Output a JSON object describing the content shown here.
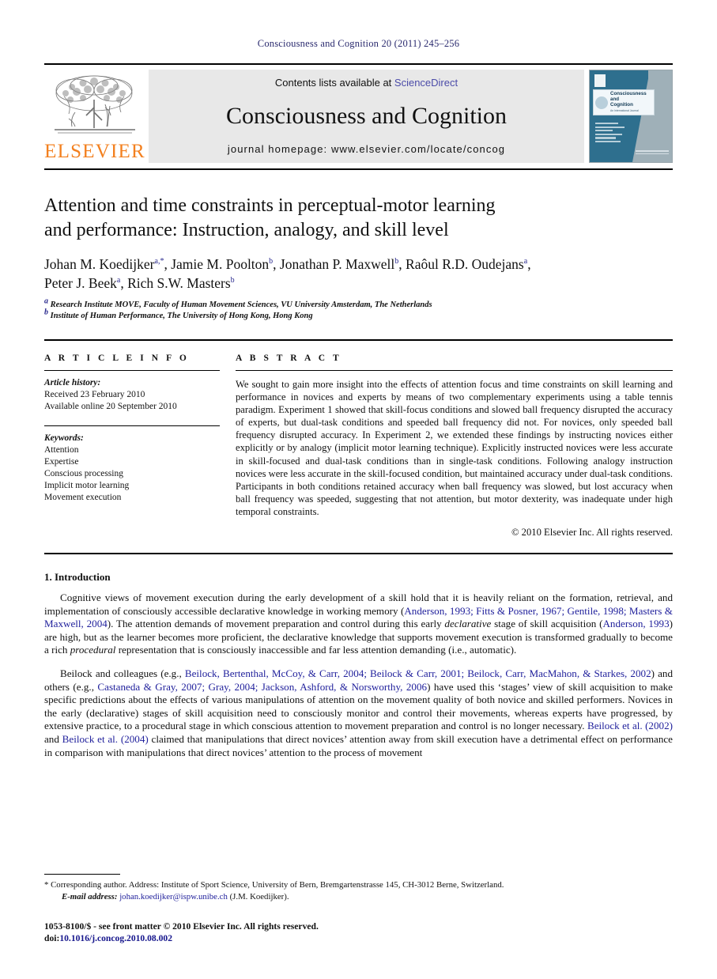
{
  "running_head": "Consciousness and Cognition 20 (2011) 245–256",
  "journal_header": {
    "publisher_logo_text": "ELSEVIER",
    "contents_prefix": "Contents lists available at ",
    "contents_link": "ScienceDirect",
    "journal_title": "Consciousness and Cognition",
    "homepage": "journal homepage: www.elsevier.com/locate/concog",
    "cover": {
      "title_line1": "Consciousness",
      "title_line2": "and",
      "title_line3": "Cognition",
      "subtitle": "An International Journal"
    }
  },
  "article": {
    "title_line1": "Attention and time constraints in perceptual-motor learning",
    "title_line2": "and performance: Instruction, analogy, and skill level",
    "authors_line1": "Johan M. Koedijker a,*, Jamie M. Poolton b, Jonathan P. Maxwell b, Raôul R.D. Oudejans a,",
    "authors_line2": "Peter J. Beek a, Rich S.W. Masters b",
    "affiliations": [
      "a Research Institute MOVE, Faculty of Human Movement Sciences, VU University Amsterdam, The Netherlands",
      "b Institute of Human Performance, The University of Hong Kong, Hong Kong"
    ]
  },
  "article_info": {
    "heading": "A R T I C L E   I N F O",
    "history_label": "Article history:",
    "history": [
      "Received 23 February 2010",
      "Available online 20 September 2010"
    ],
    "keywords_label": "Keywords:",
    "keywords": [
      "Attention",
      "Expertise",
      "Conscious processing",
      "Implicit motor learning",
      "Movement execution"
    ]
  },
  "abstract": {
    "heading": "A B S T R A C T",
    "text": "We sought to gain more insight into the effects of attention focus and time constraints on skill learning and performance in novices and experts by means of two complementary experiments using a table tennis paradigm. Experiment 1 showed that skill-focus conditions and slowed ball frequency disrupted the accuracy of experts, but dual-task conditions and speeded ball frequency did not. For novices, only speeded ball frequency disrupted accuracy. In Experiment 2, we extended these findings by instructing novices either explicitly or by analogy (implicit motor learning technique). Explicitly instructed novices were less accurate in skill-focused and dual-task conditions than in single-task conditions. Following analogy instruction novices were less accurate in the skill-focused condition, but maintained accuracy under dual-task conditions. Participants in both conditions retained accuracy when ball frequency was slowed, but lost accuracy when ball frequency was speeded, suggesting that not attention, but motor dexterity, was inadequate under high temporal constraints.",
    "copyright": "© 2010 Elsevier Inc. All rights reserved."
  },
  "body": {
    "section_heading": "1. Introduction",
    "paragraph1_part1": "Cognitive views of movement execution during the early development of a skill hold that it is heavily reliant on the formation, retrieval, and implementation of consciously accessible declarative knowledge in working memory (",
    "paragraph1_ref1": "Anderson, 1993; Fitts & Posner, 1967; Gentile, 1998; Masters & Maxwell, 2004",
    "paragraph1_part2": "). The attention demands of movement preparation and control during this early ",
    "paragraph1_ital1": "declarative",
    "paragraph1_part3": " stage of skill acquisition (",
    "paragraph1_ref2": "Anderson, 1993",
    "paragraph1_part4": ") are high, but as the learner becomes more proficient, the declarative knowledge that supports movement execution is transformed gradually to become a rich ",
    "paragraph1_ital2": "procedural",
    "paragraph1_part5": " representation that is consciously inaccessible and far less attention demanding (i.e., automatic).",
    "paragraph2_part1": "Beilock and colleagues (e.g., ",
    "paragraph2_ref1": "Beilock, Bertenthal, McCoy, & Carr, 2004; Beilock & Carr, 2001; Beilock, Carr, MacMahon, & Starkes, 2002",
    "paragraph2_part2": ") and others (e.g., ",
    "paragraph2_ref2": "Castaneda & Gray, 2007; Gray, 2004; Jackson, Ashford, & Norsworthy, 2006",
    "paragraph2_part3": ") have used this ‘stages’ view of skill acquisition to make specific predictions about the effects of various manipulations of attention on the movement quality of both novice and skilled performers. Novices in the early (declarative) stages of skill acquisition need to consciously monitor and control their movements, whereas experts have progressed, by extensive practice, to a procedural stage in which conscious attention to movement preparation and control is no longer necessary. ",
    "paragraph2_ref3": "Beilock et al. (2002)",
    "paragraph2_part4": " and ",
    "paragraph2_ref4": "Beilock et al. (2004)",
    "paragraph2_part5": " claimed that manipulations that direct novices’ attention away from skill execution have a detrimental effect on performance in comparison with manipulations that direct novices’ attention to the process of movement"
  },
  "footnote": {
    "marker": "*",
    "corresponding_text": "Corresponding author. Address: Institute of Sport Science, University of Bern, Bremgartenstrasse 145, CH-3012 Berne, Switzerland.",
    "email_label": "E-mail address:",
    "email": "johan.koedijker@ispw.unibe.ch",
    "email_suffix": " (J.M. Koedijker)."
  },
  "imprint": {
    "issn_line": "1053-8100/$ - see front matter © 2010 Elsevier Inc. All rights reserved.",
    "doi_label": "doi:",
    "doi_value": "10.1016/j.concog.2010.08.002"
  },
  "colors": {
    "link_blue": "#21219c",
    "running_head": "#2a2a6e",
    "elsevier_orange": "#F3801F",
    "sciencedirect": "#4b4ba8",
    "band_gray": "#e8e8e8"
  }
}
